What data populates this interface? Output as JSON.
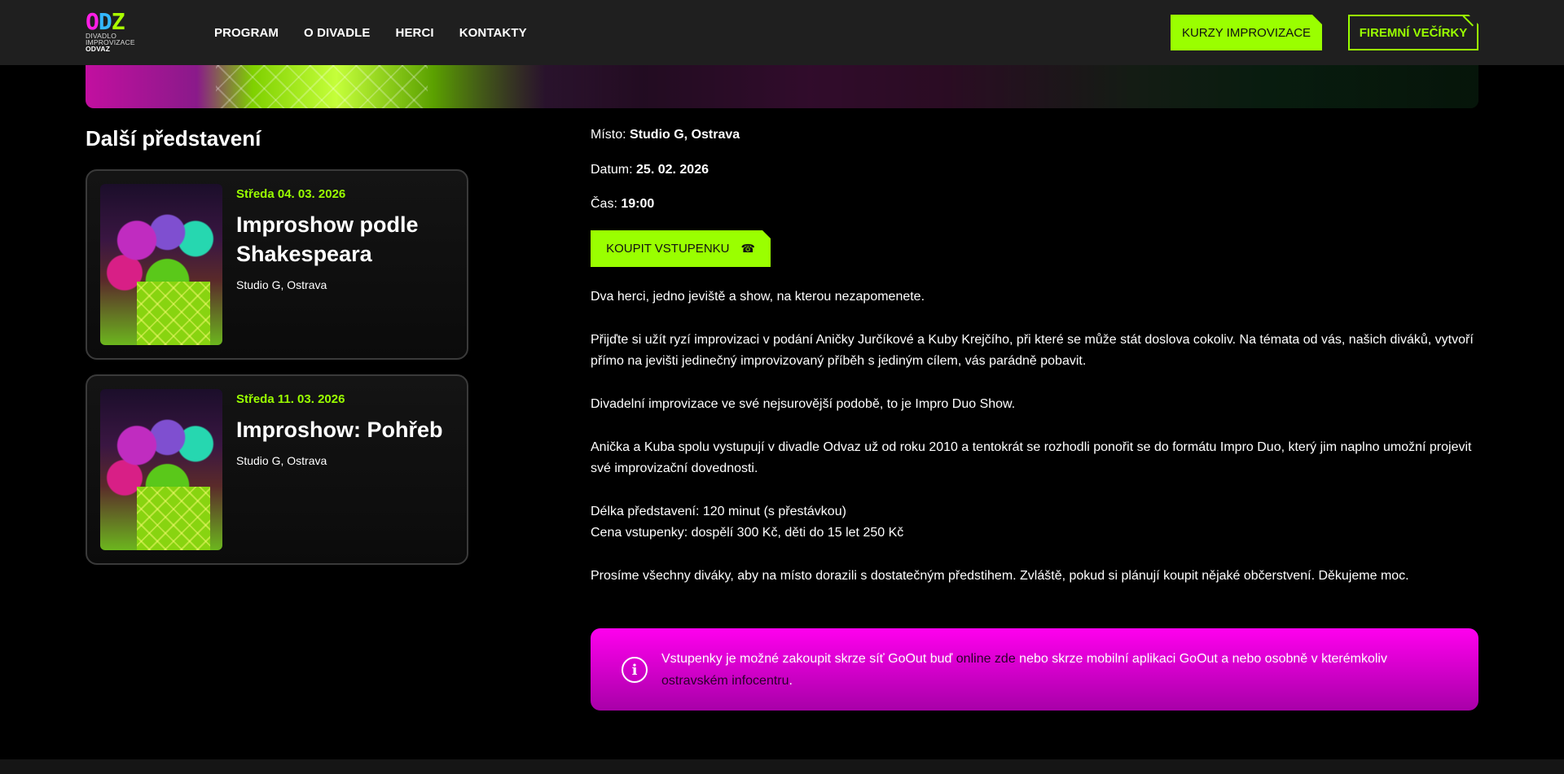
{
  "header": {
    "logo": {
      "letters": [
        "O",
        "D",
        "Z"
      ],
      "line1": "DIVADLO",
      "line2": "IMPROVIZACE",
      "line3": "ODVAZ"
    },
    "nav": [
      "PROGRAM",
      "O DIVADLE",
      "HERCI",
      "KONTAKTY"
    ],
    "cta_primary": "KURZY IMPROVIZACE",
    "cta_secondary": "FIREMNÍ VEČÍRKY"
  },
  "sidebar": {
    "title": "Další představení",
    "events": [
      {
        "date": "Středa 04. 03. 2026",
        "title": "Improshow podle Shakespeara",
        "venue": "Studio G, Ostrava"
      },
      {
        "date": "Středa 11. 03. 2026",
        "title": "Improshow: Pohřeb",
        "venue": "Studio G, Ostrava"
      }
    ]
  },
  "details": {
    "place_label": "Místo:",
    "place_value": "Studio G, Ostrava",
    "date_label": "Datum:",
    "date_value": "25. 02. 2026",
    "time_label": "Čas:",
    "time_value": "19:00",
    "buy_label": "KOUPIT VSTUPENKU",
    "paragraphs": [
      "Dva herci, jedno jeviště a show, na kterou nezapomenete.",
      "Přijďte si užít ryzí improvizaci v podání Aničky Jurčíkové a Kuby Krejčího, při které se může stát doslova cokoliv. Na témata od vás, našich diváků, vytvoří přímo na jevišti jedinečný improvizovaný příběh s jediným cílem, vás parádně pobavit.",
      "Divadelní improvizace ve své nejsurovější podobě, to je Impro Duo Show.",
      "Anička a Kuba spolu vystupují v divadle Odvaz už od roku 2010 a tentokrát se rozhodli ponořit se do formátu Impro Duo, který jim naplno umožní projevit své improvizační dovednosti."
    ],
    "length_line": "Délka představení: 120 minut (s přestávkou)",
    "price_line": "Cena vstupenky: dospělí 300 Kč, děti do 15 let 250 Kč",
    "closing": "Prosíme všechny diváky, aby na místo dorazili s dostatečným předstihem. Zvláště, pokud si plánují koupit nějaké občerstvení. Děkujeme moc."
  },
  "notice": {
    "icon": "i",
    "text_1": "Vstupenky je možné zakoupit skrze síť GoOut buď ",
    "link_1": "online zde",
    "text_2": " nebo skrze mobilní aplikaci GoOut a nebo osobně v kterémkoliv ",
    "link_2": "ostravském infocentru",
    "text_3": "."
  },
  "colors": {
    "accent": "#9aff00",
    "magenta": "#ff00ee",
    "header_bg": "#1f1f1f"
  }
}
